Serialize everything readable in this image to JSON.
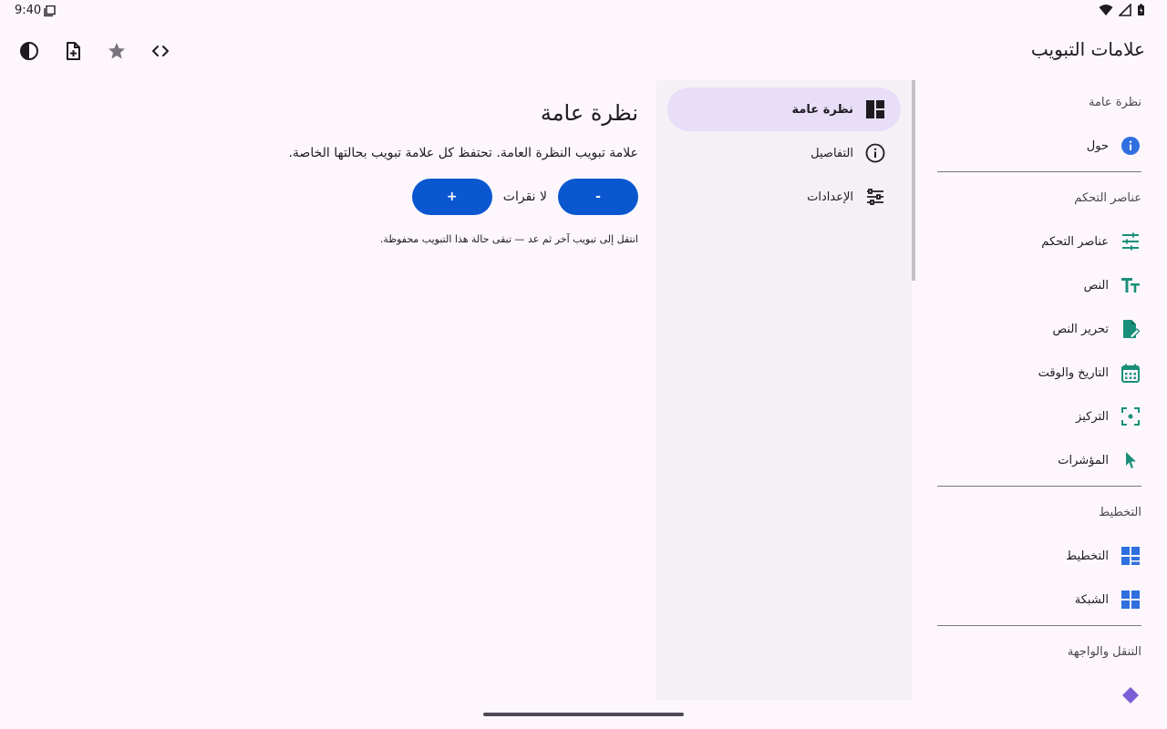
{
  "status": {
    "time": "9:40"
  },
  "app_bar": {
    "title": "علامات التبويب"
  },
  "nav": {
    "sections": [
      {
        "header": "نظرة عامة",
        "items": [
          {
            "label": "حول",
            "icon": "info-icon"
          }
        ]
      },
      {
        "header": "عناصر التحكم",
        "items": [
          {
            "label": "عناصر التحكم",
            "icon": "tune-icon"
          },
          {
            "label": "النص",
            "icon": "text-fields-icon"
          },
          {
            "label": "تحرير النص",
            "icon": "edit-document-icon"
          },
          {
            "label": "التاريخ والوقت",
            "icon": "calendar-icon"
          },
          {
            "label": "التركيز",
            "icon": "focus-icon"
          },
          {
            "label": "المؤشرات",
            "icon": "pointer-icon"
          }
        ]
      },
      {
        "header": "التخطيط",
        "items": [
          {
            "label": "التخطيط",
            "icon": "layout-icon"
          },
          {
            "label": "الشبكة",
            "icon": "grid-icon"
          }
        ]
      },
      {
        "header": "التنقل والواجهة",
        "items": [
          {
            "label": "",
            "icon": "diamond-icon"
          }
        ]
      }
    ]
  },
  "tabs_list": {
    "items": [
      {
        "label": "نظرة عامة",
        "icon": "dashboard-icon",
        "selected": true
      },
      {
        "label": "التفاصيل",
        "icon": "info-outline-icon",
        "selected": false
      },
      {
        "label": "الإعدادات",
        "icon": "settings-sliders-icon",
        "selected": false
      }
    ]
  },
  "detail": {
    "title": "نظرة عامة",
    "description": "علامة تبويب النظرة العامة. تحتفظ كل علامة تبويب بحالتها الخاصة.",
    "decrement_label": "-",
    "counter_label": "لا نقرات",
    "increment_label": "+",
    "hint": "انتقل إلى تبويب آخر ثم عد — تبقى حالة هذا التبويب محفوظة."
  },
  "colors": {
    "accent": "#0b57d0",
    "selected_bg": "#e8def8",
    "teal": "#1a8f7a",
    "blue": "#2f6fe0"
  }
}
